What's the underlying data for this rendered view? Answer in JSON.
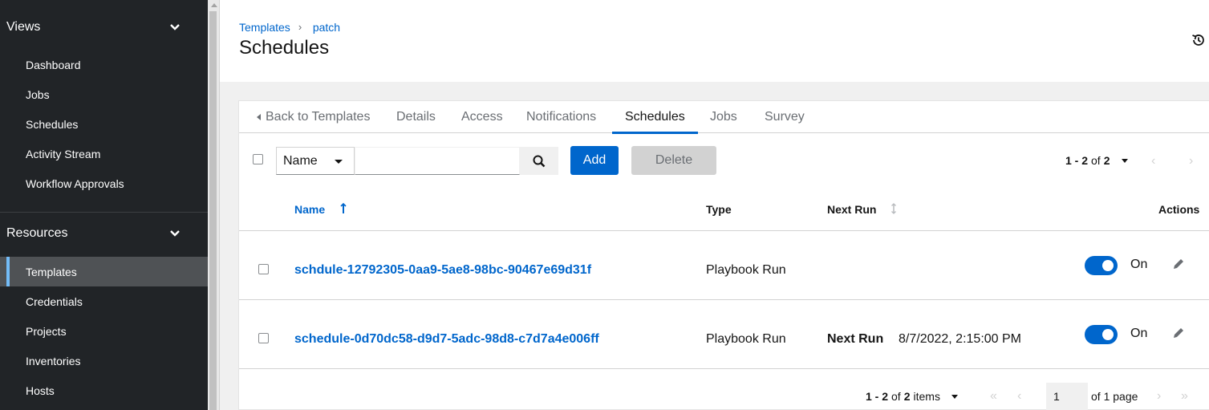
{
  "sidebar": {
    "views": {
      "label": "Views",
      "items": [
        "Dashboard",
        "Jobs",
        "Schedules",
        "Activity Stream",
        "Workflow Approvals"
      ]
    },
    "resources": {
      "label": "Resources",
      "items": [
        "Templates",
        "Credentials",
        "Projects",
        "Inventories",
        "Hosts"
      ],
      "active": "Templates"
    }
  },
  "header": {
    "breadcrumb": [
      "Templates",
      "patch"
    ],
    "title": "Schedules",
    "history_icon": "history-icon"
  },
  "tabs": [
    {
      "label": "Back to Templates"
    },
    {
      "label": "Details"
    },
    {
      "label": "Access"
    },
    {
      "label": "Notifications"
    },
    {
      "label": "Schedules",
      "active": true
    },
    {
      "label": "Jobs"
    },
    {
      "label": "Survey"
    }
  ],
  "toolbar": {
    "filter_field": "Name",
    "search_value": "",
    "add_label": "Add",
    "delete_label": "Delete",
    "pagination_range": "1 - 2",
    "pagination_of": "of",
    "pagination_total": "2"
  },
  "table": {
    "columns": {
      "name": "Name",
      "type": "Type",
      "next_run": "Next Run",
      "actions": "Actions"
    },
    "rows": [
      {
        "name": "schdule-12792305-0aa9-5ae8-98bc-90467e69d31f",
        "type": "Playbook Run",
        "next_run_label": "",
        "next_run_value": "",
        "toggle": "On"
      },
      {
        "name": "schedule-0d70dc58-d9d7-5adc-98d8-c7d7a4e006ff",
        "type": "Playbook Run",
        "next_run_label": "Next Run",
        "next_run_value": "8/7/2022, 2:15:00 PM",
        "toggle": "On"
      }
    ]
  },
  "footer": {
    "range": "1 - 2",
    "of": "of",
    "total": "2",
    "items_word": "items",
    "page_value": "1",
    "of_pages": "of 1 page"
  },
  "colors": {
    "accent": "#0066cc",
    "sidebar_bg": "#212427",
    "active_nav_bg": "#4f5255",
    "active_indicator": "#73bcf7"
  }
}
